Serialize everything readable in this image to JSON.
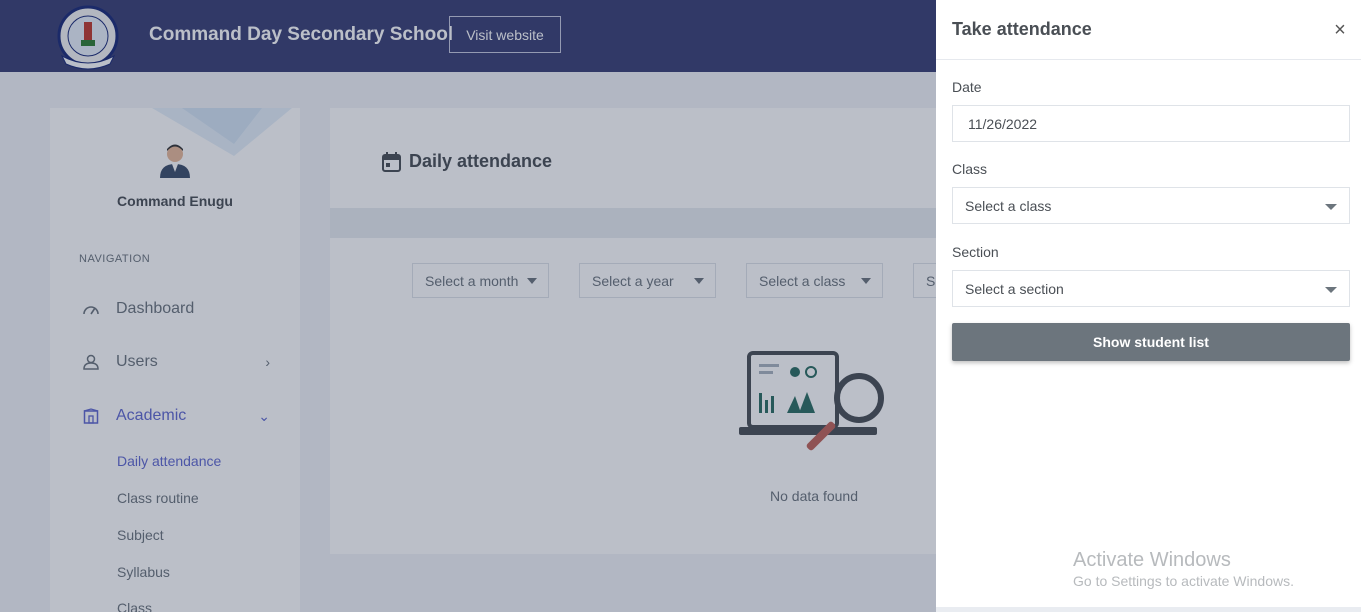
{
  "header": {
    "school_name": "Command Day Secondary School",
    "visit_label": "Visit website"
  },
  "sidebar": {
    "user_name": "Command Enugu",
    "nav_title": "NAVIGATION",
    "items": [
      {
        "label": "Dashboard",
        "icon": "gauge-icon"
      },
      {
        "label": "Users",
        "icon": "user-icon"
      },
      {
        "label": "Academic",
        "icon": "school-icon"
      }
    ],
    "sub_items": [
      "Daily attendance",
      "Class routine",
      "Subject",
      "Syllabus",
      "Class"
    ]
  },
  "main": {
    "title": "Daily attendance",
    "filters": [
      "Select a month",
      "Select a year",
      "Select a class",
      "Se"
    ],
    "empty_text": "No data found"
  },
  "panel": {
    "title": "Take attendance",
    "close": "×",
    "date_label": "Date",
    "date_value": "11/26/2022",
    "class_label": "Class",
    "class_value": "Select a class",
    "section_label": "Section",
    "section_value": "Select a section",
    "button_label": "Show student list"
  },
  "watermark": {
    "title": "Activate Windows",
    "subtitle": "Go to Settings to activate Windows."
  },
  "colors": {
    "topbar": "#3a4074",
    "accent": "#6169d0",
    "button": "#6c757d"
  }
}
